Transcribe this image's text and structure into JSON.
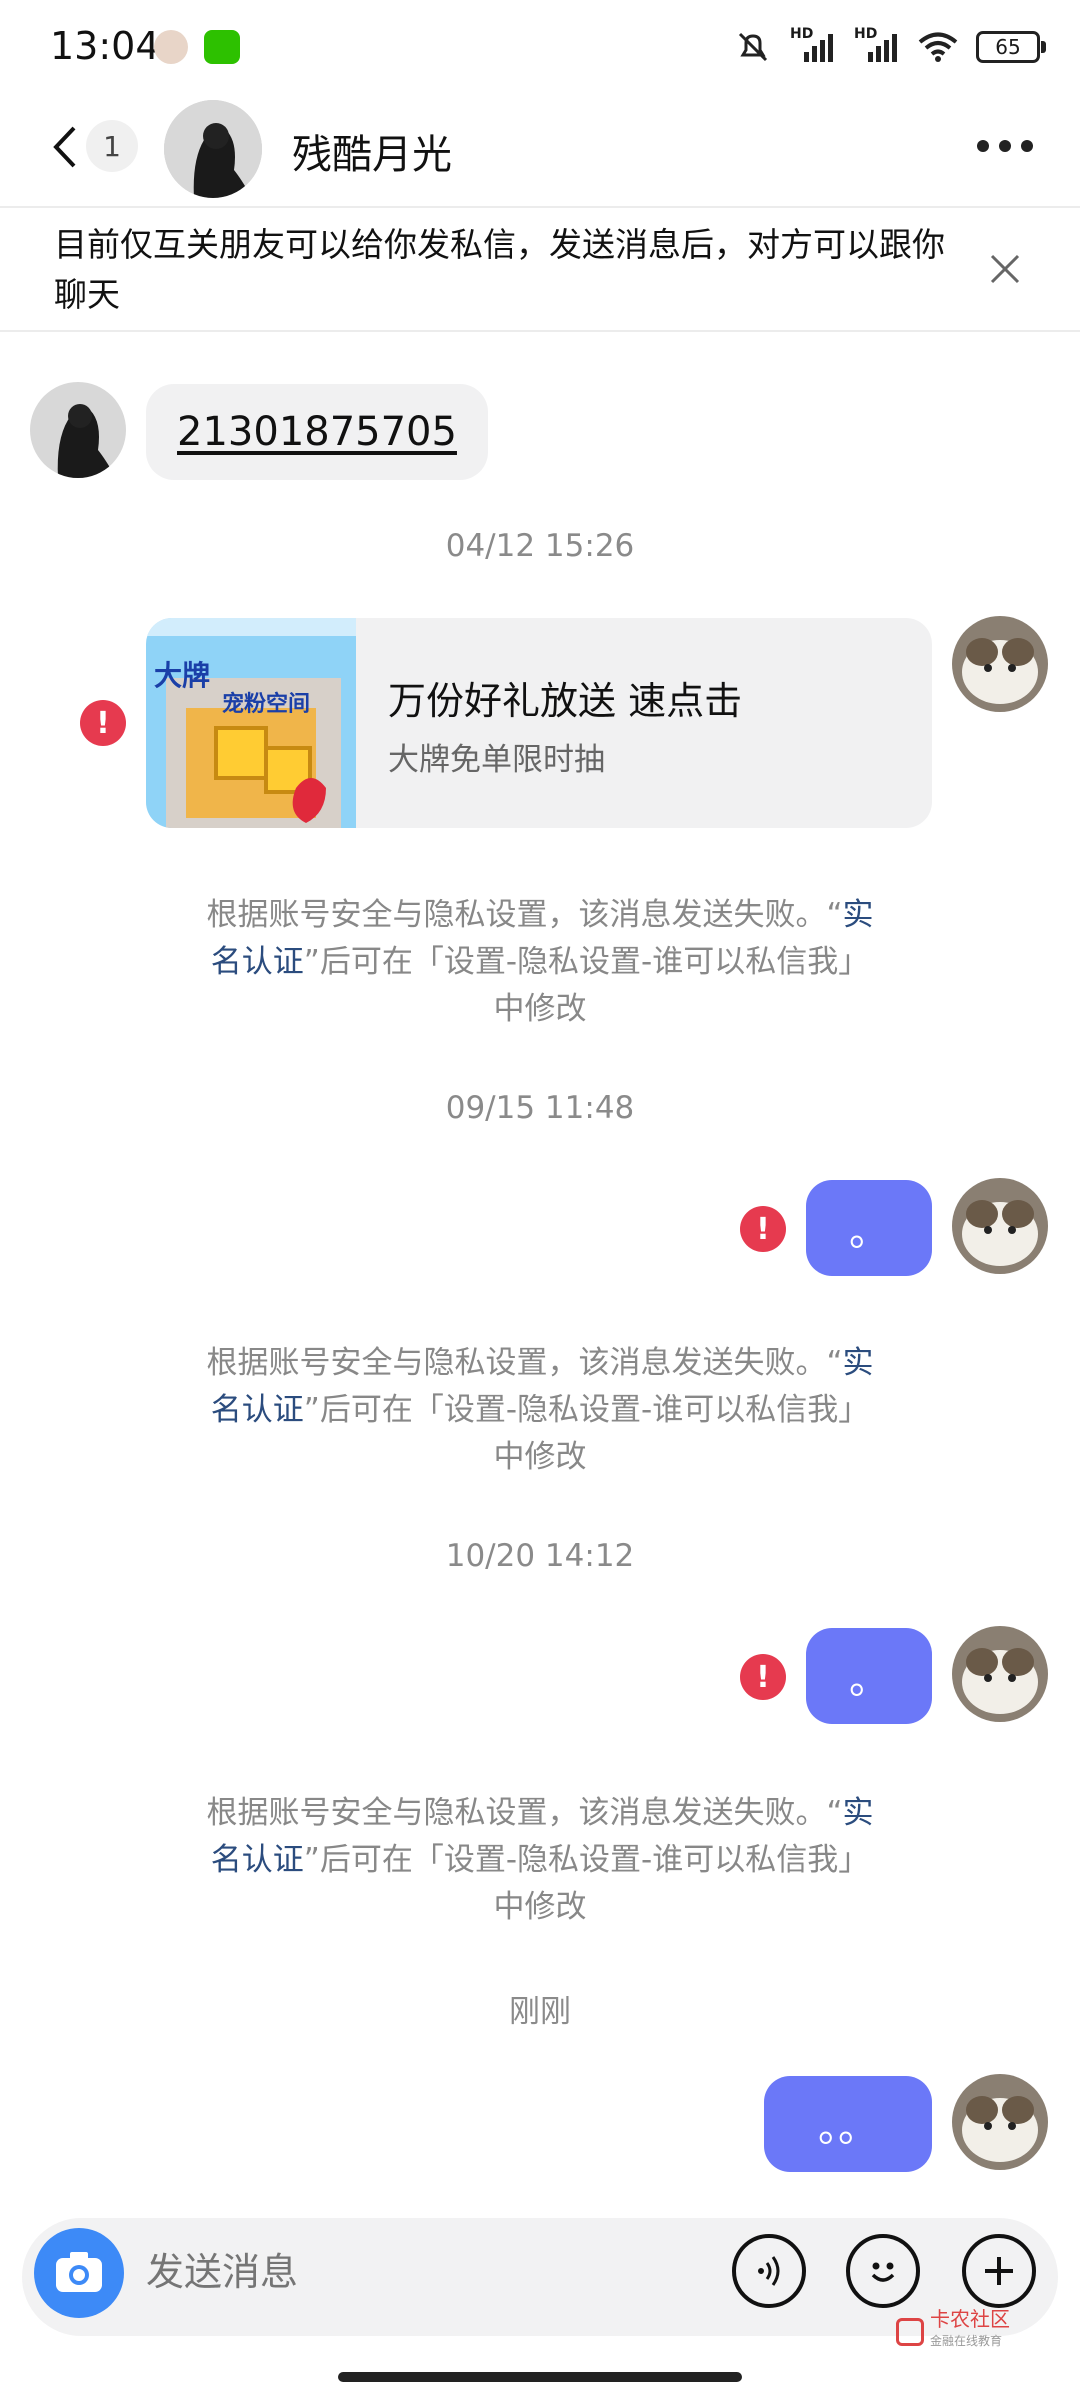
{
  "status_bar": {
    "time": "13:04",
    "network_badge_1": "HD",
    "network_badge_2": "HD",
    "battery_level": "65"
  },
  "header": {
    "unread_count": "1",
    "title": "残酷月光"
  },
  "notice": {
    "text": "目前仅互关朋友可以给你发私信，发送消息后，对方可以跟你聊天"
  },
  "messages": {
    "incoming_phone": "21301875705",
    "timestamp_1": "04/12 15:26",
    "card_title": "万份好礼放送 速点击",
    "card_subtitle": "大牌免单限时抽",
    "card_thumb_text_1": "大牌",
    "card_thumb_text_2": "宠粉空间",
    "system_notice": {
      "prefix": "根据账号安全与隐私设置，该消息发送失败。“",
      "link": "实名认证",
      "suffix": "”后可在「设置-隐私设置-谁可以私信我」中修改"
    },
    "timestamp_2": "09/15 11:48",
    "outgoing_1": "。",
    "timestamp_3": "10/20 14:12",
    "outgoing_2": "。",
    "timestamp_4": "刚刚",
    "outgoing_3": "。。"
  },
  "composer": {
    "placeholder": "发送消息"
  },
  "watermark": {
    "text": "卡农社区",
    "subtext": "金融在线教育"
  },
  "colors": {
    "bubble_sent": "#6b78f8",
    "error_red": "#e63a4f",
    "link_blue": "#2b4c7e",
    "camera_blue": "#3d8af7"
  }
}
